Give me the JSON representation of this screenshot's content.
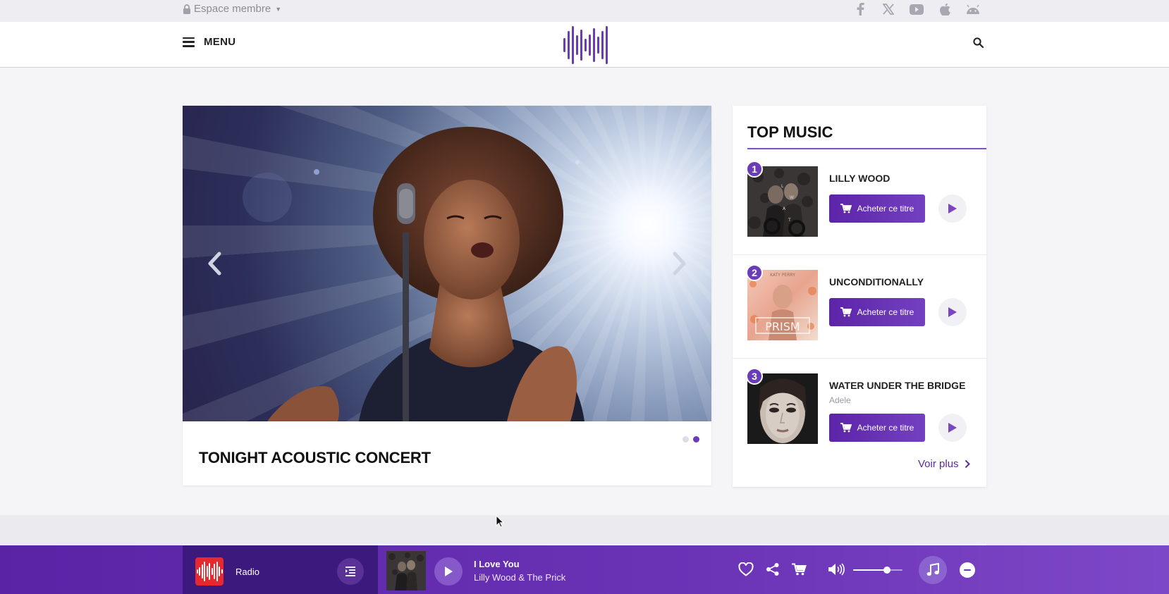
{
  "topbar": {
    "member_label": "Espace membre",
    "socials": [
      "facebook-icon",
      "x-icon",
      "youtube-icon",
      "apple-icon",
      "android-icon"
    ]
  },
  "header": {
    "menu_label": "MENU"
  },
  "hero": {
    "title": "TONIGHT ACOUSTIC CONCERT",
    "slides_count": 2,
    "active_slide": 2
  },
  "top_music": {
    "title": "TOP MUSIC",
    "buy_label": "Acheter ce titre",
    "more_label": "Voir plus",
    "tracks": [
      {
        "rank": "1",
        "name": "LILLY WOOD",
        "artist": ""
      },
      {
        "rank": "2",
        "name": "UNCONDITIONALLY",
        "artist": ""
      },
      {
        "rank": "3",
        "name": "WATER UNDER THE BRIDGE",
        "artist": "Adele"
      }
    ]
  },
  "player": {
    "source_label": "Radio",
    "track_title": "I Love You",
    "track_artist": "Lilly Wood & The Prick",
    "volume": 0.68
  },
  "colors": {
    "accent": "#6a3cb8",
    "player_bg": "#6b33b6",
    "player_left_bg": "#3c1a7d",
    "radio_logo": "#e8282f"
  }
}
